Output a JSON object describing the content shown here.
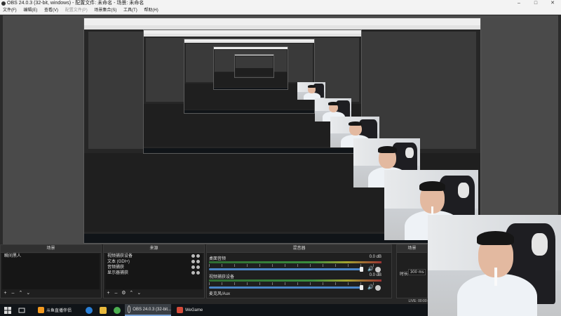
{
  "window": {
    "title": "OBS 24.0.3 (32-bit, windows) - 配置文件: 未命名 - 场景: 未命名",
    "minimize": "–",
    "maximize": "□",
    "close": "✕"
  },
  "menu": [
    "文件(F)",
    "编辑(E)",
    "查看(V)",
    "配置文件(P)",
    "场景集合(S)",
    "工具(T)",
    "帮助(H)"
  ],
  "docks": {
    "scenes": {
      "header": "场景",
      "items": [
        "瞬间黑人"
      ]
    },
    "sources": {
      "header": "来源",
      "items": [
        "视频捕获设备",
        "文本 (GDI+)",
        "音频捕获",
        "显示器捕获"
      ]
    },
    "mixer": {
      "header": "混音器",
      "channels": [
        {
          "name": "桌面音频",
          "db": "0.0 dB"
        },
        {
          "name": "视频捕获设备",
          "db": "0.0 dB"
        },
        {
          "name": "麦克风/Aux",
          "db": ""
        }
      ]
    },
    "transitions": {
      "header": "场景",
      "duration_label": "时长",
      "duration_value": "300 ms"
    }
  },
  "footer_icons": [
    "+",
    "–",
    "⌃",
    "⌄"
  ],
  "status": {
    "text": "LIVE: 00:00:"
  },
  "taskbar": {
    "tasks": [
      {
        "label": "斗鱼直播伴侣",
        "color": "#f39a20"
      },
      {
        "label": "OBS 24.0.3 (32-bit...",
        "color": "#2c2c2c"
      },
      {
        "label": "WeGame",
        "color": "#d64b3a"
      }
    ]
  },
  "colors": {
    "accent": "#4b86c7",
    "meter_green": "#3b8e3f"
  }
}
